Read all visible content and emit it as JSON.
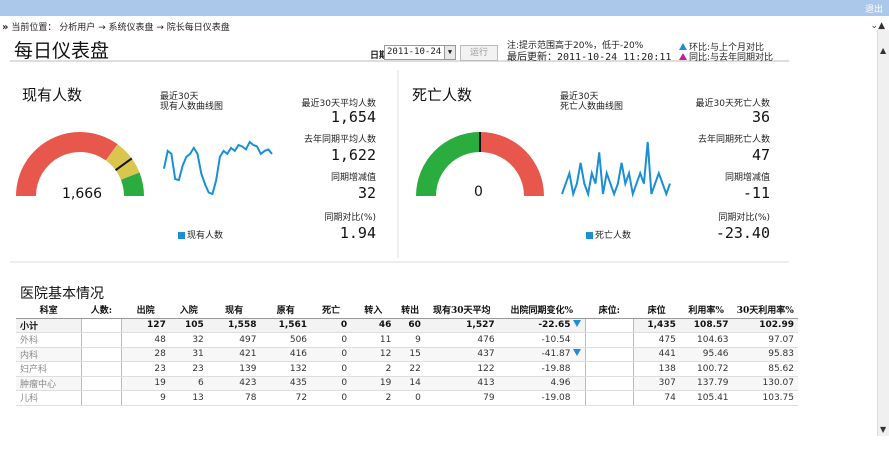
{
  "topbar": {
    "logout_label": "退出"
  },
  "breadcrumb": {
    "arrow": "»",
    "text": "当前位置： 分析用户 → 系统仪表盘 → 院长每日仪表盘"
  },
  "page": {
    "title": "每日仪表盘",
    "date_label": "日期",
    "date_value": "2011-10-24",
    "run_label": "运行",
    "note_line1": "注:提示范围高于20%，低于-20%",
    "note_line2": "最后更新：2011-10-24 11:20:11",
    "legend_mom": "环比:与上个月对比",
    "legend_yoy": "同比:与去年同期对比"
  },
  "colors": {
    "accent_blue": "#1a8fd6",
    "accent_magenta": "#c0209a",
    "gauge_red": "#e8574c",
    "gauge_yellow": "#d9c64e",
    "gauge_green": "#2aad3e",
    "topbar": "#a9c8ea"
  },
  "inpatients": {
    "title": "现有人数",
    "chart_title_1": "最近30天",
    "chart_title_2": "现有人数曲线图",
    "gauge_value": "1,666",
    "gauge_fraction": 0.8,
    "legend": "现有人数",
    "avg_label": "最近30天平均人数",
    "avg_value": "1,654",
    "ly_label": "去年同期平均人数",
    "ly_value": "1,622",
    "diff_label": "同期增减值",
    "diff_value": "32",
    "ratio_label": "同期对比(%)",
    "ratio_value": "1.94",
    "series": [
      1640,
      1700,
      1690,
      1605,
      1602,
      1650,
      1680,
      1690,
      1710,
      1690,
      1625,
      1588,
      1560,
      1555,
      1600,
      1680,
      1700,
      1690,
      1710,
      1700,
      1720,
      1715,
      1705,
      1730,
      1720,
      1715,
      1690,
      1700,
      1705,
      1690
    ]
  },
  "deaths": {
    "title": "死亡人数",
    "chart_title_1": "最近30天",
    "chart_title_2": "死亡人数曲线图",
    "gauge_value": "0",
    "gauge_fraction": 0.0,
    "legend": "死亡人数",
    "avg_label": "最近30天死亡人数",
    "avg_value": "36",
    "ly_label": "去年同期死亡人数",
    "ly_value": "47",
    "diff_label": "同期增减值",
    "diff_value": "-11",
    "ratio_label": "同期对比(%)",
    "ratio_value": "-23.40",
    "series": [
      0,
      1,
      2,
      0,
      1,
      3,
      1,
      0,
      2,
      1,
      4,
      0,
      2,
      1,
      0,
      1,
      3,
      1,
      2,
      0,
      1,
      2,
      1,
      5,
      0,
      1,
      2,
      1,
      0,
      1
    ]
  },
  "hospital": {
    "title": "医院基本情况",
    "columns": [
      "科室",
      "人数:",
      "出院",
      "入院",
      "现有",
      "原有",
      "死亡",
      "转入",
      "转出",
      "现有30天平均",
      "出院同期变化%",
      "床位:",
      "床位",
      "利用率%",
      "30天利用率%"
    ],
    "rows": [
      {
        "name": "小计",
        "cells": [
          "127",
          "105",
          "1,558",
          "1,561",
          "0",
          "46",
          "60",
          "1,527",
          "-22.65"
        ],
        "down": true,
        "beds": [
          "1,435",
          "108.57",
          "102.99"
        ]
      },
      {
        "name": "外科",
        "cells": [
          "48",
          "32",
          "497",
          "506",
          "0",
          "11",
          "9",
          "476",
          "-10.54"
        ],
        "down": false,
        "beds": [
          "475",
          "104.63",
          "97.07"
        ]
      },
      {
        "name": "内科",
        "cells": [
          "28",
          "31",
          "421",
          "416",
          "0",
          "12",
          "15",
          "437",
          "-41.87"
        ],
        "down": true,
        "beds": [
          "441",
          "95.46",
          "95.83"
        ]
      },
      {
        "name": "妇产科",
        "cells": [
          "23",
          "23",
          "139",
          "132",
          "0",
          "2",
          "22",
          "122",
          "-19.88"
        ],
        "down": false,
        "beds": [
          "138",
          "100.72",
          "85.62"
        ]
      },
      {
        "name": "肿瘤中心",
        "cells": [
          "19",
          "6",
          "423",
          "435",
          "0",
          "19",
          "14",
          "413",
          "4.96"
        ],
        "down": false,
        "beds": [
          "307",
          "137.79",
          "130.07"
        ]
      },
      {
        "name": "儿科",
        "cells": [
          "9",
          "13",
          "78",
          "72",
          "0",
          "2",
          "0",
          "79",
          "-19.08"
        ],
        "down": false,
        "beds": [
          "74",
          "105.41",
          "103.75"
        ]
      }
    ]
  }
}
